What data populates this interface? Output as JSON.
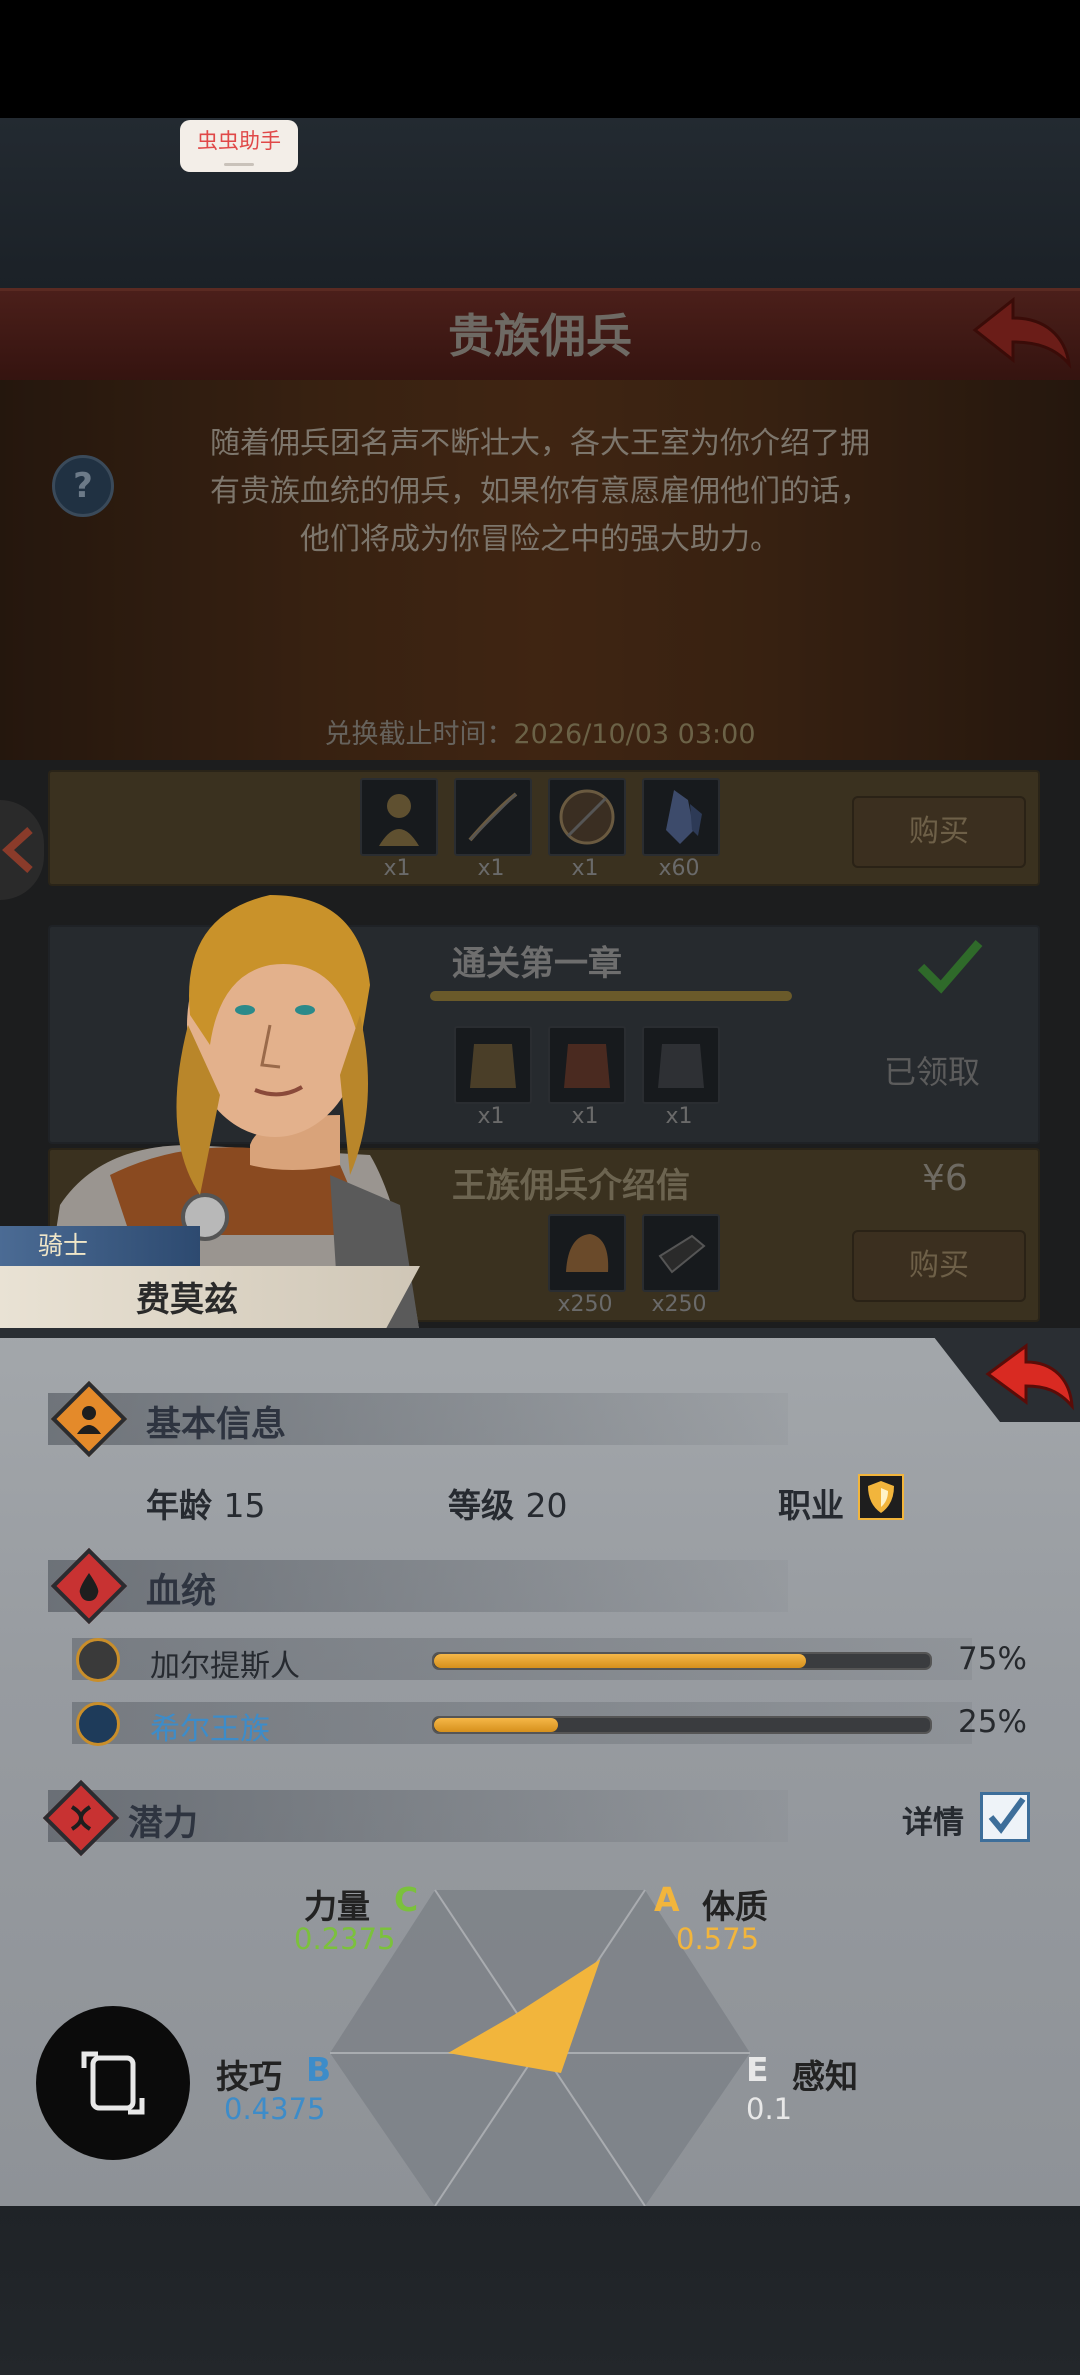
{
  "overlay": {
    "assistant_label": "虫虫助手"
  },
  "store": {
    "title": "贵族佣兵",
    "description": [
      "随着佣兵团名声不断壮大，各大王室为你介绍了拥",
      "有贵族血统的佣兵，如果你有意愿雇佣他们的话，",
      "他们将成为你冒险之中的强大助力。"
    ],
    "deadline_label": "兑换截止时间：",
    "deadline_value": "2026/10/03 03:00",
    "offers": [
      {
        "quantities": [
          "x1",
          "x1",
          "x1",
          "x60"
        ],
        "button": "购买"
      },
      {
        "title": "通关第一章",
        "quantities": [
          "x1",
          "x1",
          "x1"
        ],
        "status": "已领取"
      },
      {
        "title": "王族佣兵介绍信",
        "price": "¥6",
        "quantities": [
          "x250",
          "x250"
        ],
        "button": "购买"
      }
    ]
  },
  "hero": {
    "class": "骑士",
    "name": "费莫兹"
  },
  "basic_info": {
    "title": "基本信息",
    "age_label": "年龄",
    "age": "15",
    "level_label": "等级",
    "level": "20",
    "job_label": "职业"
  },
  "bloodline": {
    "title": "血统",
    "items": [
      {
        "name": "加尔提斯人",
        "percent_label": "75%",
        "value": 0.75,
        "icon": "beast-emblem-icon"
      },
      {
        "name": "希尔王族",
        "percent_label": "25%",
        "value": 0.25,
        "icon": "royal-emblem-icon",
        "color": "#3d8cc9"
      }
    ]
  },
  "potential": {
    "title": "潜力",
    "detail_label": "详情",
    "stats": [
      {
        "name": "力量",
        "grade": "C",
        "value": "0.2375",
        "color": "#7bc13c"
      },
      {
        "name": "体质",
        "grade": "A",
        "value": "0.575",
        "color": "#f2b53c"
      },
      {
        "name": "技巧",
        "grade": "B",
        "value": "0.4375",
        "color": "#3d8cc9"
      },
      {
        "name": "感知",
        "grade": "E",
        "value": "0.1",
        "color": "#e8e8e8"
      }
    ]
  },
  "colors": {
    "accent_orange": "#f2b53c",
    "back_red": "#d92a22",
    "panel_gray": "#9da1a6"
  }
}
